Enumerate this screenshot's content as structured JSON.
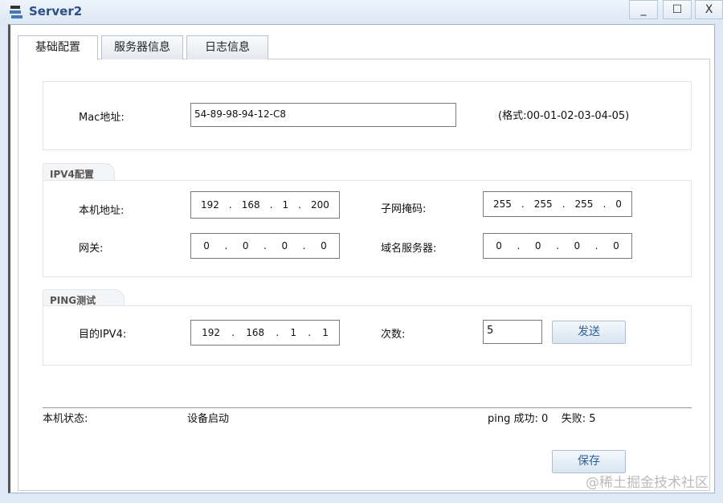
{
  "window": {
    "title": "Server2",
    "minimize": "_",
    "maximize": "☐",
    "close": "X"
  },
  "tabs": [
    {
      "label": "基础配置",
      "active": true
    },
    {
      "label": "服务器信息"
    },
    {
      "label": "日志信息"
    }
  ],
  "mac": {
    "label": "Mac地址:",
    "value": "54-89-98-94-12-C8",
    "hint": "(格式:00-01-02-03-04-05)"
  },
  "ipv4": {
    "section": "IPV4配置",
    "host_label": "本机地址:",
    "host": [
      "192",
      "168",
      "1",
      "200"
    ],
    "mask_label": "子网掩码:",
    "mask": [
      "255",
      "255",
      "255",
      "0"
    ],
    "gateway_label": "网关:",
    "gateway": [
      "0",
      "0",
      "0",
      "0"
    ],
    "dns_label": "域名服务器:",
    "dns": [
      "0",
      "0",
      "0",
      "0"
    ]
  },
  "ping": {
    "section": "PING测试",
    "target_label": "目的IPV4:",
    "target": [
      "192",
      "168",
      "1",
      "1"
    ],
    "count_label": "次数:",
    "count": "5",
    "send": "发送"
  },
  "status": {
    "label": "本机状态:",
    "value": "设备启动",
    "result": "ping 成功: 0    失败: 5"
  },
  "save": "保存",
  "watermark": "@稀土掘金技术社区"
}
